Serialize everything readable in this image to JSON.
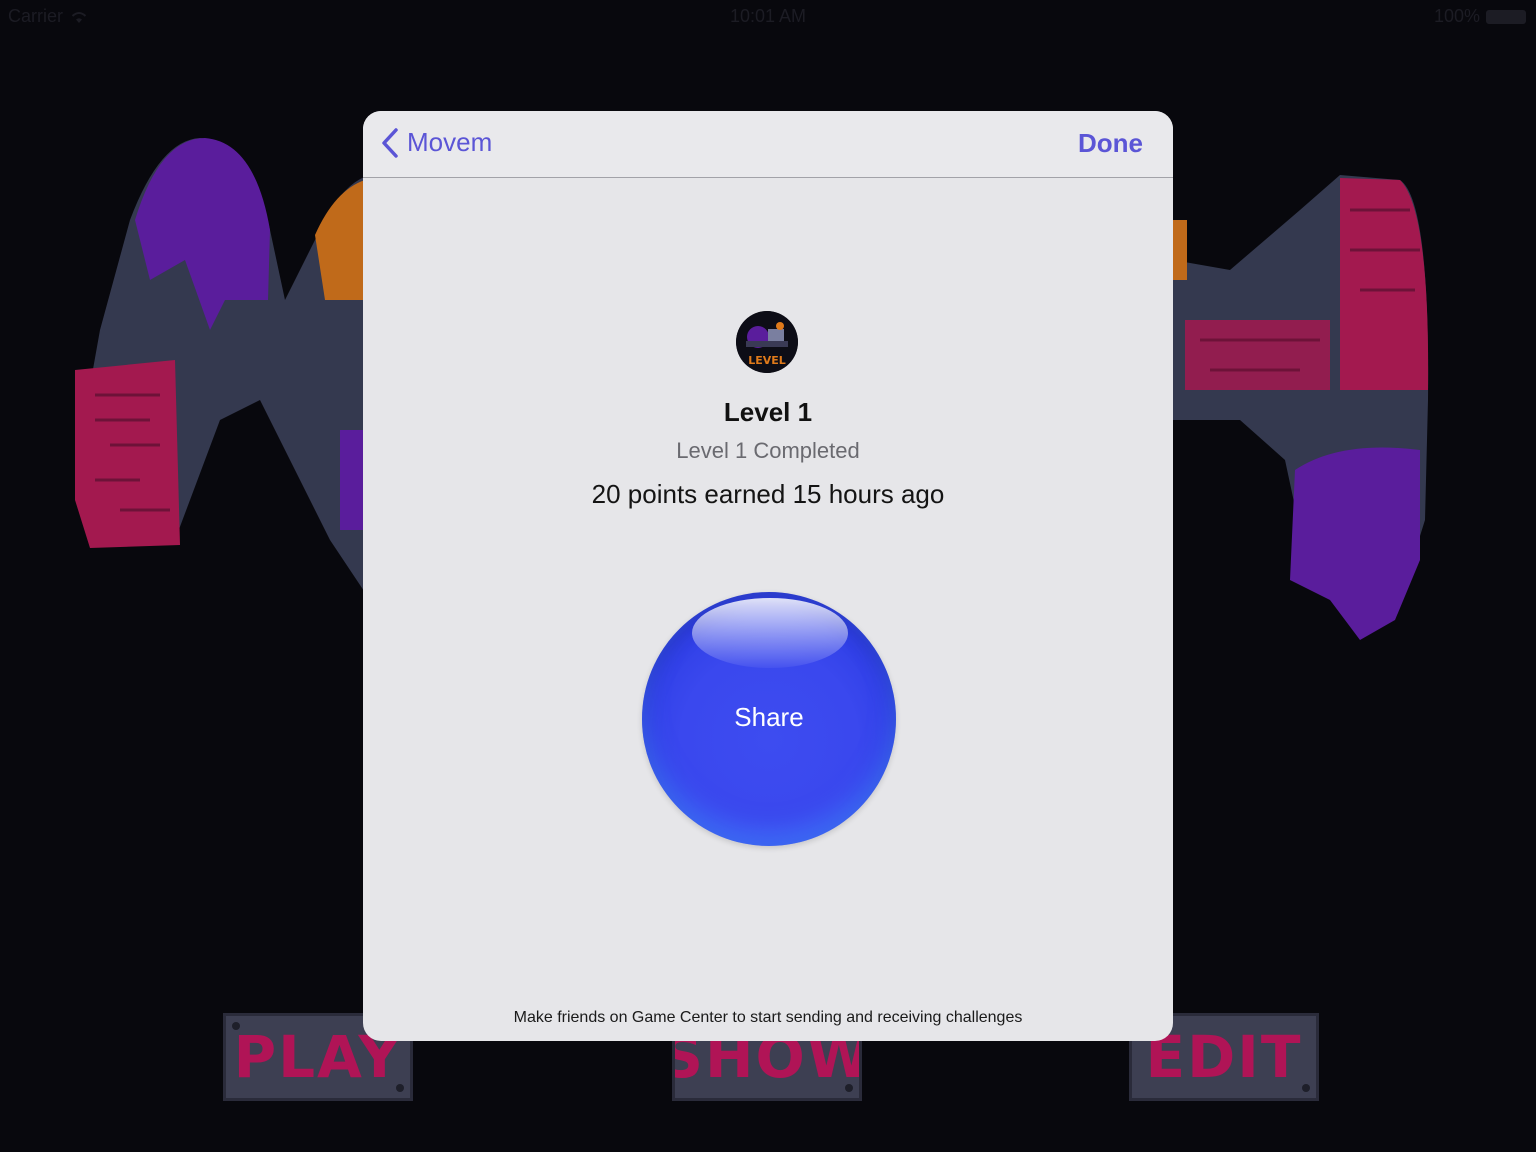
{
  "status_bar": {
    "carrier": "Carrier",
    "time": "10:01 AM",
    "battery": "100%"
  },
  "background": {
    "menu": {
      "play_label": "PLAY",
      "show_label": "SHOW",
      "edit_label": "EDIT"
    }
  },
  "modal": {
    "back_label": "Movem",
    "done_label": "Done",
    "achievement": {
      "title": "Level 1",
      "description": "Level 1 Completed",
      "points": "20 points earned 15 hours ago",
      "icon": "level-badge-icon",
      "icon_text": "LEVEL"
    },
    "share_label": "Share",
    "footer_note": "Make friends on Game Center to start sending and receiving challenges"
  },
  "colors": {
    "accent": "#5b55d6",
    "share_blue": "#3a48ee",
    "modal_bg": "#e6e6e9"
  }
}
